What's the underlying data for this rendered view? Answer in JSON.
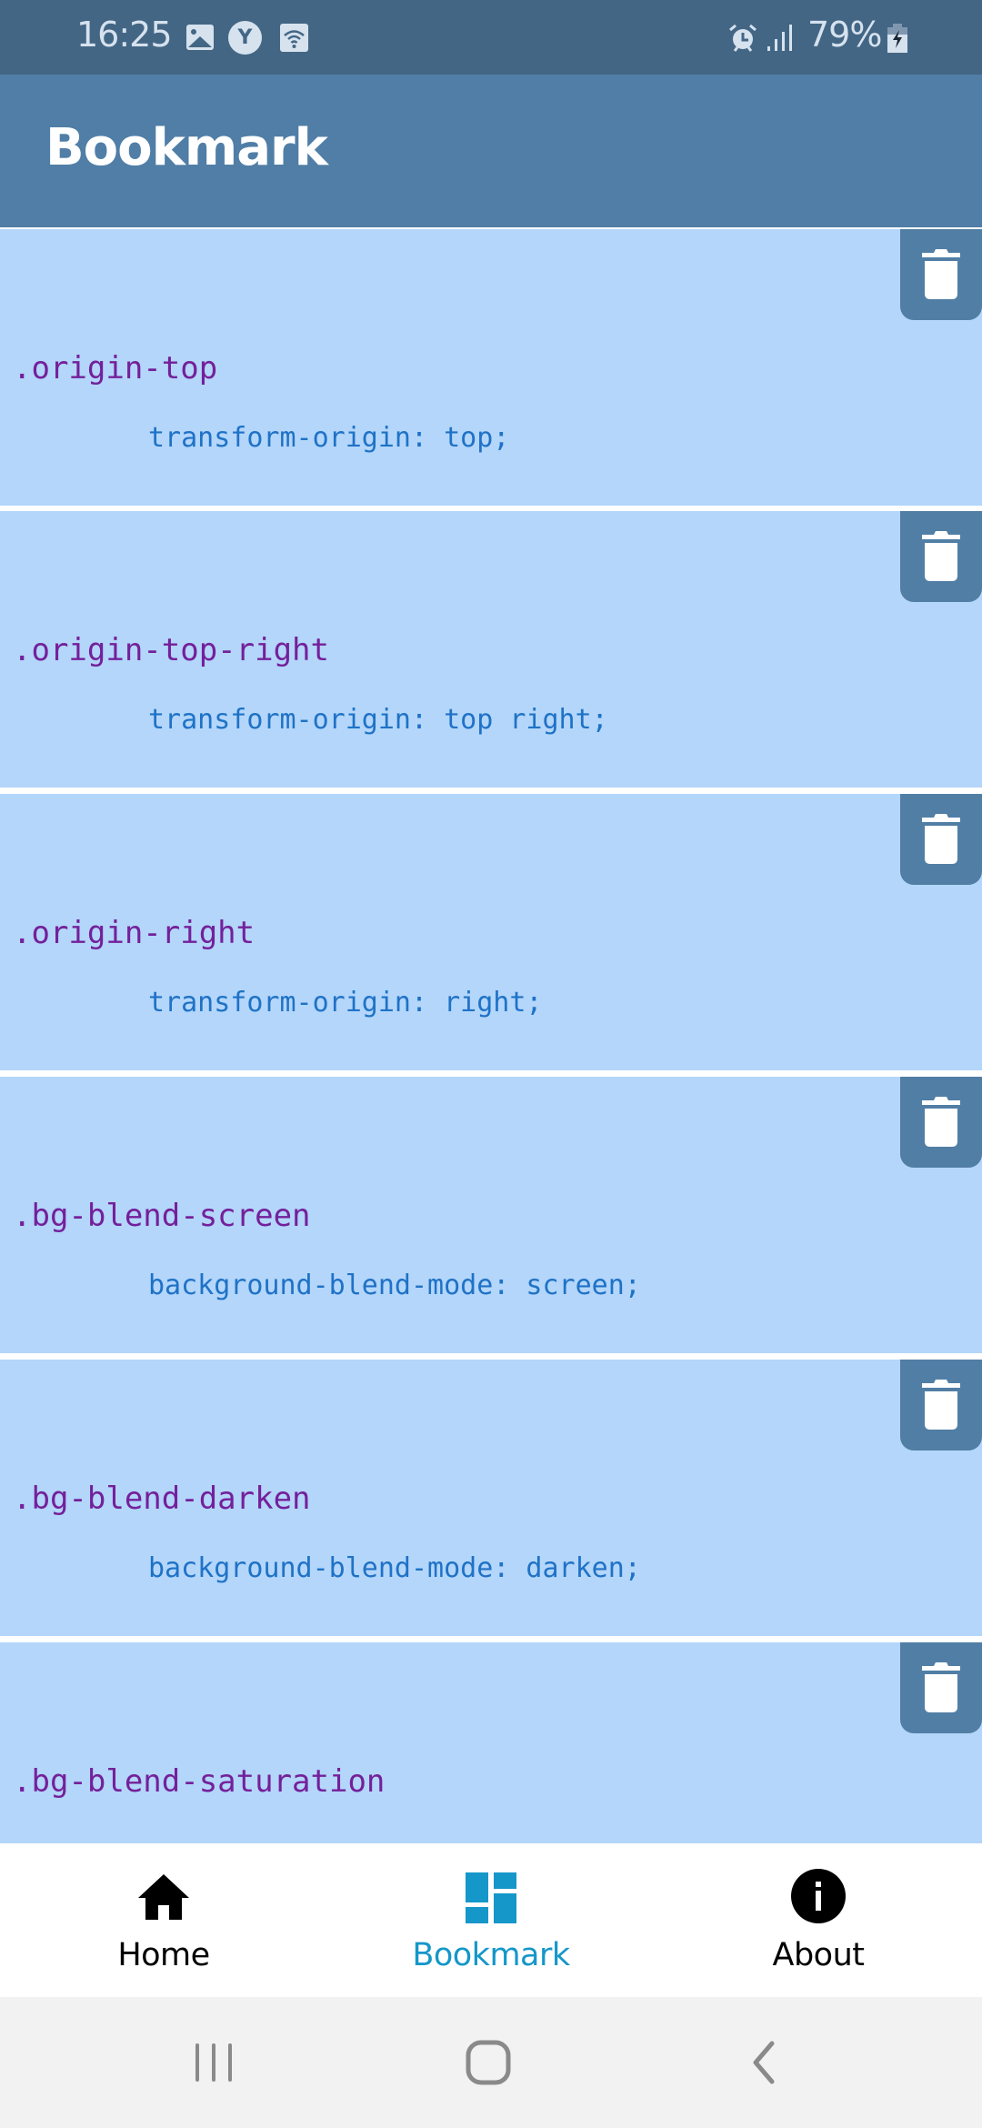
{
  "status_bar": {
    "time": "16:25",
    "notification_icons": [
      "gallery-icon",
      "y-app-icon",
      "wifi-calling-icon"
    ],
    "y_icon_letter": "Y",
    "system_icons": [
      "alarm-icon",
      "signal-icon",
      "battery-charging-icon"
    ],
    "battery_percent": "79%"
  },
  "app_bar": {
    "title": "Bookmark"
  },
  "colors": {
    "status_bar": "#436685",
    "app_bar": "#507ea6",
    "card_bg": "#b3d6fa",
    "delete_button": "#517ea5",
    "class_name": "#74209b",
    "property": "#1f72c6",
    "nav_active": "#1597c9"
  },
  "bookmarks": [
    {
      "class_name": ".origin-top",
      "declaration": "transform-origin: top;",
      "delete_icon": "trash-icon"
    },
    {
      "class_name": ".origin-top-right",
      "declaration": "transform-origin: top right;",
      "delete_icon": "trash-icon"
    },
    {
      "class_name": ".origin-right",
      "declaration": "transform-origin: right;",
      "delete_icon": "trash-icon"
    },
    {
      "class_name": ".bg-blend-screen",
      "declaration": "background-blend-mode: screen;",
      "delete_icon": "trash-icon"
    },
    {
      "class_name": ".bg-blend-darken",
      "declaration": "background-blend-mode: darken;",
      "delete_icon": "trash-icon"
    },
    {
      "class_name": ".bg-blend-saturation",
      "declaration": "",
      "delete_icon": "trash-icon"
    }
  ],
  "bottom_nav": {
    "items": [
      {
        "label": "Home",
        "icon": "home-icon",
        "active": false
      },
      {
        "label": "Bookmark",
        "icon": "dashboard-icon",
        "active": true
      },
      {
        "label": "About",
        "icon": "info-icon",
        "active": false
      }
    ]
  },
  "system_nav": {
    "buttons": [
      "recent-apps",
      "home",
      "back"
    ]
  }
}
